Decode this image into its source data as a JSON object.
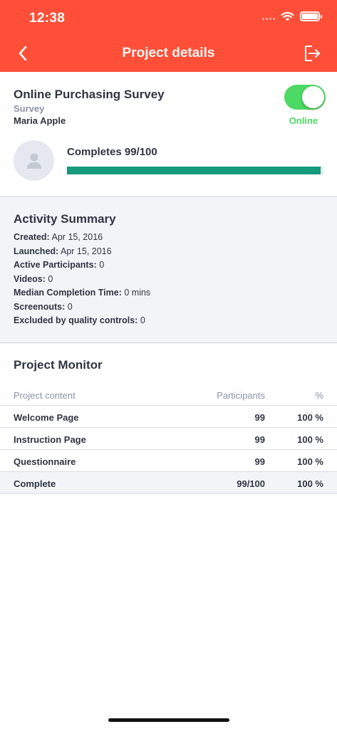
{
  "status_bar": {
    "time": "12:38"
  },
  "nav": {
    "title": "Project details"
  },
  "project": {
    "name": "Online Purchasing Survey",
    "type": "Survey",
    "owner": "Maria Apple",
    "status_label": "Online",
    "online": true,
    "completes_label": "Completes 99/100",
    "completes_fraction": 0.99
  },
  "activity": {
    "title": "Activity Summary",
    "items": [
      {
        "label": "Created:",
        "value": "Apr 15, 2016"
      },
      {
        "label": "Launched:",
        "value": "Apr 15, 2016"
      },
      {
        "label": "Active Participants:",
        "value": "0"
      },
      {
        "label": "Videos:",
        "value": "0"
      },
      {
        "label": "Median Completion Time:",
        "value": "0 mins"
      },
      {
        "label": "Screenouts:",
        "value": "0"
      },
      {
        "label": "Excluded by quality controls:",
        "value": "0"
      }
    ]
  },
  "monitor": {
    "title": "Project Monitor",
    "columns": [
      "Project content",
      "Participants",
      "%"
    ],
    "rows": [
      {
        "name": "Welcome Page",
        "participants": "99",
        "percent": "100 %"
      },
      {
        "name": "Instruction Page",
        "participants": "99",
        "percent": "100 %"
      },
      {
        "name": "Questionnaire",
        "participants": "99",
        "percent": "100 %"
      },
      {
        "name": "Complete",
        "participants": "99/100",
        "percent": "100 %"
      }
    ]
  },
  "colors": {
    "header": "#ff4f38",
    "toggle_on": "#4cd964",
    "progress": "#159a7c",
    "section_bg": "#f2f4f8"
  }
}
